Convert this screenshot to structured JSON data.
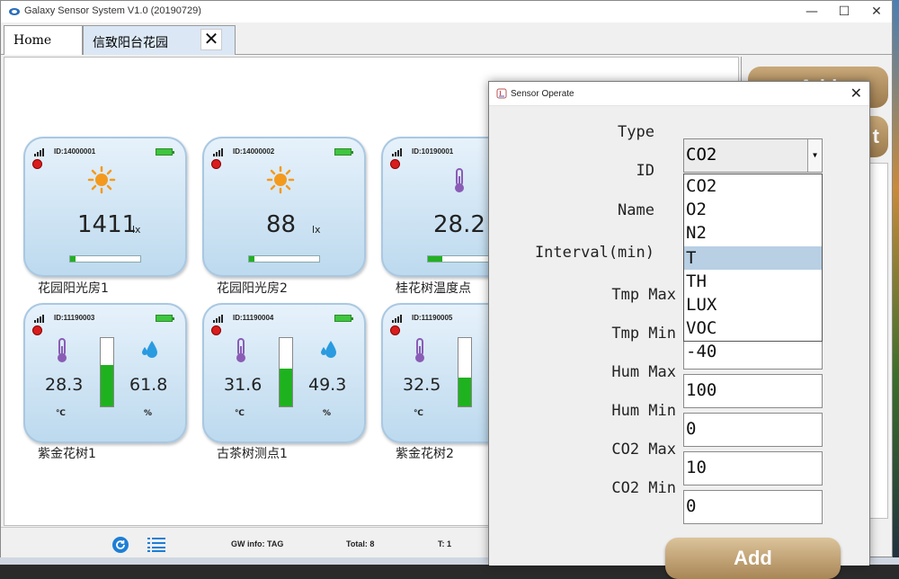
{
  "window": {
    "title": "Galaxy Sensor System V1.0   (20190729)",
    "minimize": "—",
    "maximize": "☐",
    "close": "✕"
  },
  "tabs": [
    {
      "label": "Home"
    },
    {
      "label": "信致阳台花园",
      "close": "✕"
    }
  ],
  "side_panel": {
    "add_label": "Add",
    "edit_label": "t"
  },
  "cards": [
    {
      "id": "ID:14000001",
      "value": "1411",
      "unit": "lx",
      "label": "花园阳光房1",
      "progress": 0.08
    },
    {
      "id": "ID:14000002",
      "value": "88",
      "unit": "lx",
      "label": "花园阳光房2",
      "progress": 0.08
    },
    {
      "id": "ID:10190001",
      "value": "28.2",
      "label": "桂花树温度点",
      "progress": 0.2
    },
    {
      "id": "ID:11190003",
      "temp": "28.3",
      "temp_unit": "℃",
      "hum": "61.8",
      "hum_unit": "%",
      "label": "紫金花树1",
      "level": 0.6
    },
    {
      "id": "ID:11190004",
      "temp": "31.6",
      "temp_unit": "℃",
      "hum": "49.3",
      "hum_unit": "%",
      "label": "古茶树测点1",
      "level": 0.55
    },
    {
      "id": "ID:11190005",
      "temp": "32.5",
      "temp_unit": "℃",
      "label": "紫金花树2",
      "level": 0.42
    }
  ],
  "status": {
    "gw_info": "GW info: TAG",
    "total": "Total: 8",
    "t": "T:  1"
  },
  "dialog": {
    "title": "Sensor Operate",
    "close": "✕",
    "labels": {
      "type": "Type",
      "id": "ID",
      "name": "Name",
      "interval": "Interval(min)",
      "tmp_max": "Tmp Max",
      "tmp_min": "Tmp Min",
      "hum_max": "Hum Max",
      "hum_min": "Hum Min",
      "co2_max": "CO2 Max",
      "co2_min": "CO2 Min"
    },
    "type_selected": "CO2",
    "type_options": [
      "CO2",
      "O2",
      "N2",
      "T",
      "TH",
      "LUX",
      "VOC"
    ],
    "highlighted_option": "T",
    "values": {
      "tmp_min": "-40",
      "hum_max": "100",
      "hum_min": "0",
      "co2_max": "10",
      "co2_min": "0"
    },
    "add_label": "Add"
  },
  "colors": {
    "accent_button": "#b08f60",
    "card_bg": "#cfe3f2",
    "gauge_fill": "#1fb21f",
    "alarm": "#d91c1c",
    "selection": "#b8cfe4"
  }
}
